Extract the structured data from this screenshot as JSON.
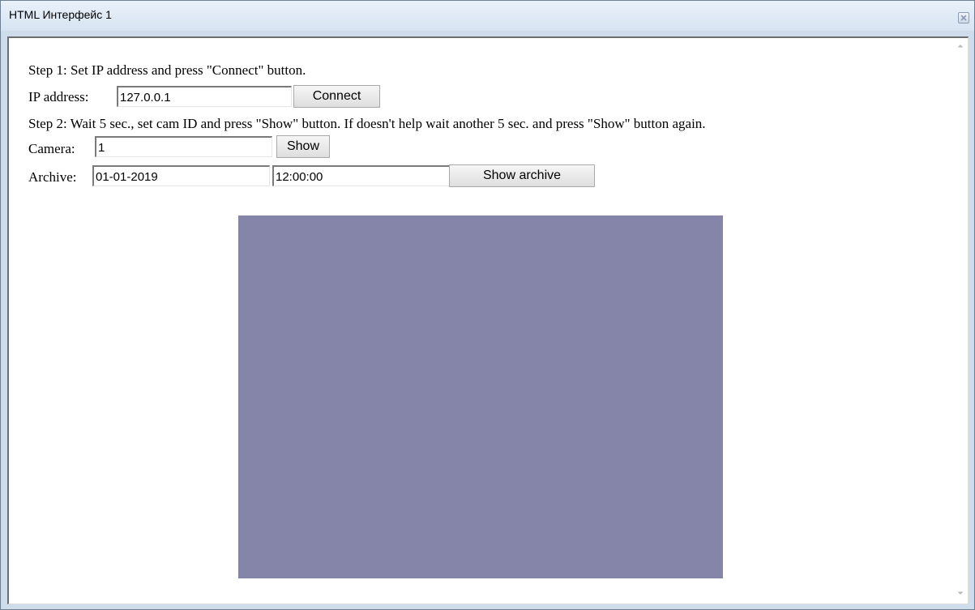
{
  "window": {
    "title": "HTML Интерфейс 1"
  },
  "step1": {
    "text": "Step 1: Set IP address and press \"Connect\" button.",
    "ip_label": "IP address:",
    "ip_value": "127.0.0.1",
    "connect_label": "Connect"
  },
  "step2": {
    "text": "Step 2: Wait 5 sec., set cam ID and press \"Show\" button. If doesn't help wait another 5 sec. and press \"Show\" button again.",
    "camera_label": "Camera:",
    "camera_value": "1",
    "show_label": "Show"
  },
  "archive": {
    "label": "Archive:",
    "date_value": "01-01-2019",
    "time_value": "12:00:00",
    "button_label": "Show archive"
  },
  "video": {
    "color": "#8584a9"
  },
  "icons": {
    "close": "close-icon",
    "scroll_up": "chevron-up-icon",
    "scroll_down": "chevron-down-icon"
  }
}
